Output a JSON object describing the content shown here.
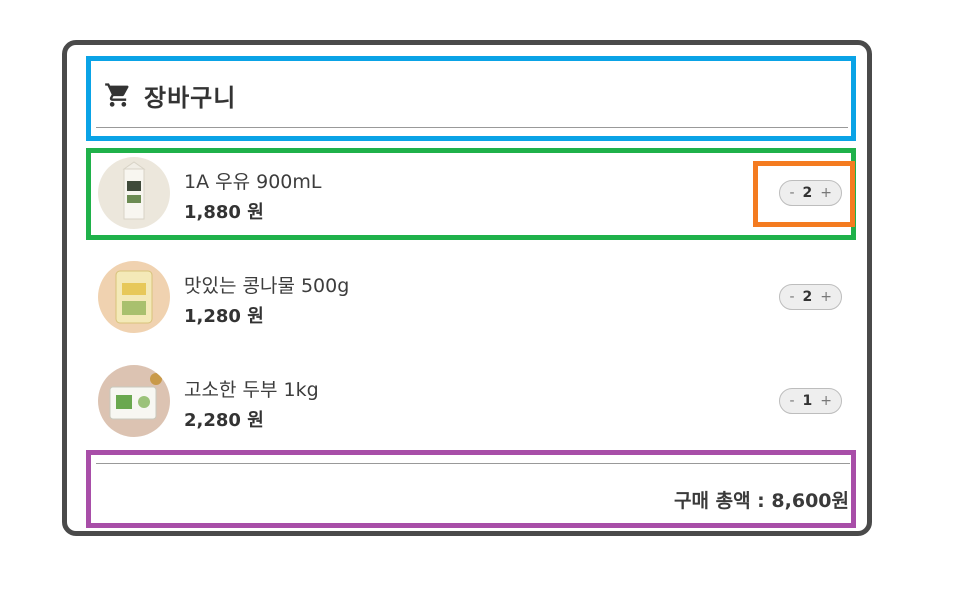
{
  "header": {
    "title": "장바구니",
    "icon": "cart-icon"
  },
  "items": [
    {
      "name": "1A 우유 900mL",
      "price": "1,880 원",
      "quantity": "2",
      "minus": "-",
      "plus": "+",
      "image": "milk-carton"
    },
    {
      "name": "맛있는 콩나물 500g",
      "price": "1,280 원",
      "quantity": "2",
      "minus": "-",
      "plus": "+",
      "image": "bean-sprouts-pack"
    },
    {
      "name": "고소한 두부 1kg",
      "price": "2,280 원",
      "quantity": "1",
      "minus": "-",
      "plus": "+",
      "image": "tofu-pack"
    }
  ],
  "footer": {
    "total_label": "구매 총액 : ",
    "total_value": "8,600원"
  },
  "colors": {
    "frame": "#4a4a4a",
    "header_highlight": "#0aa3e6",
    "item_highlight": "#1fb14a",
    "stepper_highlight": "#f47b20",
    "footer_highlight": "#a84ea8"
  }
}
